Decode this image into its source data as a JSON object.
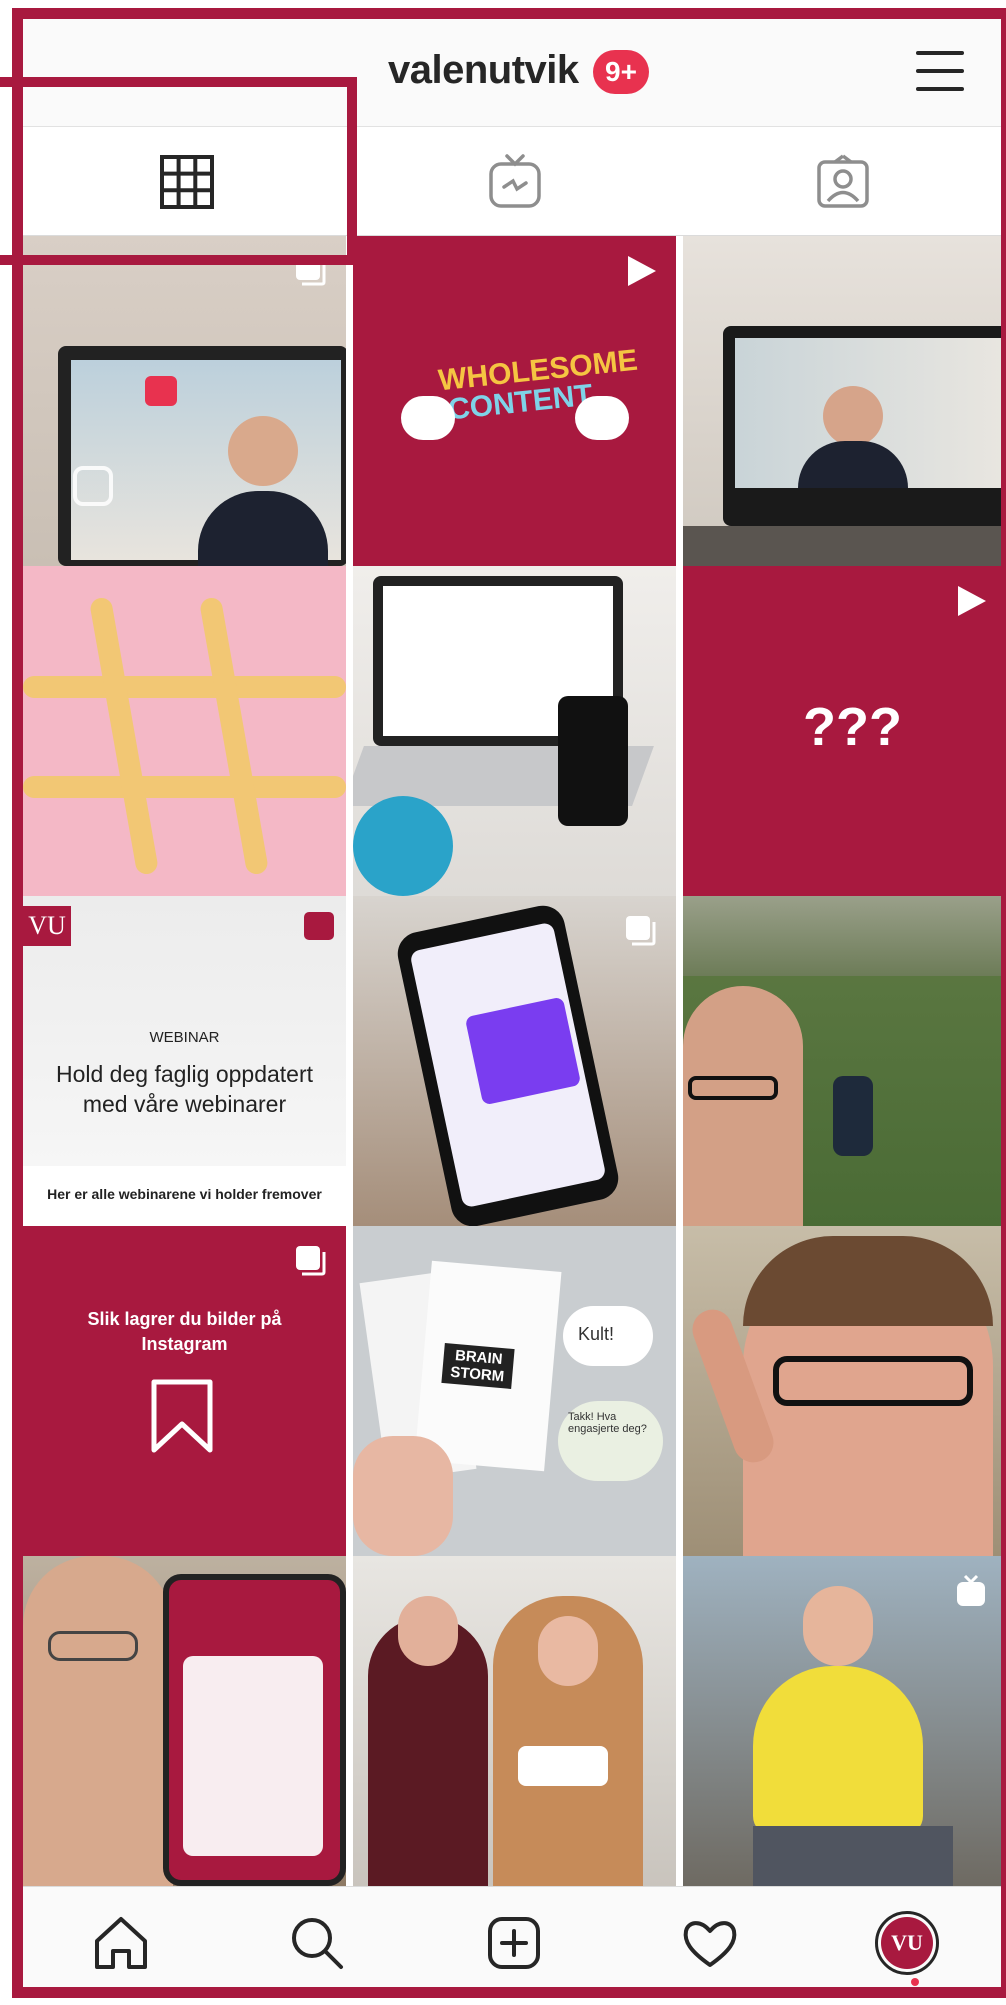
{
  "header": {
    "username": "valenutvik",
    "notification_badge": "9+",
    "menu_icon": "hamburger-menu-icon"
  },
  "tabs": [
    {
      "name": "grid-tab",
      "icon": "grid-icon",
      "selected": true
    },
    {
      "name": "igtv-tab",
      "icon": "igtv-icon",
      "selected": false
    },
    {
      "name": "tagged-tab",
      "icon": "tagged-person-icon",
      "selected": false
    }
  ],
  "posts": {
    "wholesome": {
      "line1": "WHOLESOME",
      "line2": "CONTENT"
    },
    "question": {
      "text": "???"
    },
    "webinar": {
      "logo": "VU",
      "eyebrow": "WEBINAR",
      "headline_line1": "Hold deg faglig oppdatert",
      "headline_line2": "med våre webinarer",
      "footer": "Her er alle webinarene vi holder fremover"
    },
    "save_tip": {
      "line1": "Slik lagrer du bilder på",
      "line2": "Instagram"
    },
    "brainstorm": {
      "card": "BRAIN STORM",
      "note1": "Kult!",
      "note2": "Takk! Hva engasjerte deg?"
    }
  },
  "bottom_nav": [
    {
      "name": "home",
      "icon": "home-icon"
    },
    {
      "name": "search",
      "icon": "search-icon"
    },
    {
      "name": "new-post",
      "icon": "add-post-icon"
    },
    {
      "name": "activity",
      "icon": "heart-icon"
    },
    {
      "name": "profile",
      "icon": "profile-avatar-icon",
      "label": "VU"
    }
  ],
  "colors": {
    "brand": "#a8193f",
    "badge": "#e8324f",
    "text": "#262626"
  }
}
